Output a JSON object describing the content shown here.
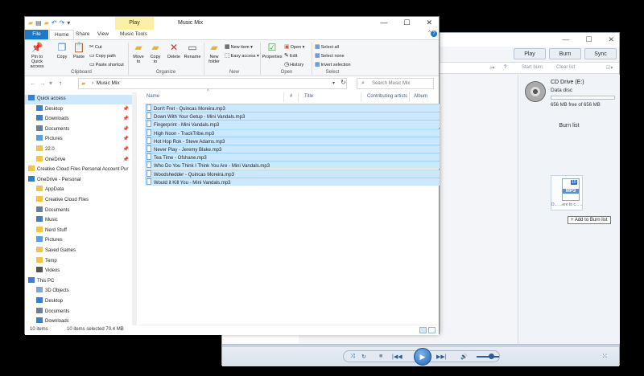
{
  "wmp": {
    "tabs": [
      "Play",
      "Burn",
      "Sync"
    ],
    "toolbar": {
      "start_burn": "Start burn",
      "clear_list": "Clear list"
    },
    "left_label": "ylists",
    "drive": {
      "name": "CD Drive (E:)",
      "type": "Data disc",
      "free": "656 MB free of 656 MB",
      "fill_percent": 0
    },
    "burn_list_title": "Burn list",
    "drag": {
      "tag": "MP3",
      "num": "10",
      "ghost_text": "D... ...ere to c... ...n list."
    },
    "drop_tooltip": "+ Add to Burn list",
    "controls": {
      "shuffle": "⤨",
      "repeat": "↻",
      "stop": "■",
      "prev": "|◀◀",
      "play": "▶",
      "next": "▶▶|",
      "mute": "🔊",
      "switch": "⁙"
    }
  },
  "explorer": {
    "title": "Music Mix",
    "context_tab": "Play",
    "ribbon_tabs": [
      "File",
      "Home",
      "Share",
      "View",
      "Music Tools"
    ],
    "ribbon": {
      "pin": "Pin to Quick access",
      "copy": "Copy",
      "paste": "Paste",
      "cut": "Cut",
      "copy_path": "Copy path",
      "paste_shortcut": "Paste shortcut",
      "clipboard": "Clipboard",
      "move_to": "Move to",
      "copy_to": "Copy to",
      "delete": "Delete",
      "rename": "Rename",
      "organize": "Organize",
      "new_folder": "New folder",
      "new_item": "New item",
      "easy_access": "Easy access",
      "new": "New",
      "properties": "Properties",
      "open": "Open",
      "edit": "Edit",
      "history": "History",
      "open_group": "Open",
      "select_all": "Select all",
      "select_none": "Select none",
      "invert_selection": "Invert selection",
      "select": "Select"
    },
    "address": "Music Mix",
    "search_placeholder": "Search Music Mix",
    "columns": [
      "Name",
      "#",
      "Title",
      "Contributing artists",
      "Album"
    ],
    "nav": [
      {
        "label": "Quick access",
        "pin": false,
        "sel": true,
        "color": "#3a7fd5"
      },
      {
        "label": "Desktop",
        "pin": true,
        "color": "#3a7fd5"
      },
      {
        "label": "Downloads",
        "pin": true,
        "color": "#3a7fd5"
      },
      {
        "label": "Documents",
        "pin": true,
        "color": "#6a7f9a"
      },
      {
        "label": "Pictures",
        "pin": true,
        "color": "#5aa0e0"
      },
      {
        "label": "22.0",
        "pin": true,
        "color": "#f3c44b"
      },
      {
        "label": "OneDrive",
        "pin": true,
        "color": "#f3c44b"
      },
      {
        "label": "Creative Cloud Files Personal Account Pur",
        "pin": false,
        "color": "#f3c44b"
      },
      {
        "label": "OneDrive - Personal",
        "pin": false,
        "color": "#2b7cd3"
      },
      {
        "label": "AppData",
        "pin": false,
        "color": "#f3c44b"
      },
      {
        "label": "Creative Cloud Files",
        "pin": false,
        "color": "#f3c44b"
      },
      {
        "label": "Documents",
        "pin": false,
        "color": "#6a7f9a"
      },
      {
        "label": "Music",
        "pin": false,
        "color": "#3a7fd5"
      },
      {
        "label": "Nerd Stuff",
        "pin": false,
        "color": "#f3c44b"
      },
      {
        "label": "Pictures",
        "pin": false,
        "color": "#5aa0e0"
      },
      {
        "label": "Saved Games",
        "pin": false,
        "color": "#f3c44b"
      },
      {
        "label": "Temp",
        "pin": false,
        "color": "#f3c44b"
      },
      {
        "label": "Videos",
        "pin": false,
        "color": "#555"
      },
      {
        "label": "This PC",
        "pin": false,
        "color": "#3a7fd5"
      },
      {
        "label": "3D Objects",
        "pin": false,
        "color": "#7aa8d8"
      },
      {
        "label": "Desktop",
        "pin": false,
        "color": "#3a7fd5"
      },
      {
        "label": "Documents",
        "pin": false,
        "color": "#6a7f9a"
      },
      {
        "label": "Downloads",
        "pin": false,
        "color": "#3a7fd5"
      }
    ],
    "files": [
      "Don't Fret - Quincas Moreira.mp3",
      "Down With Your Getup - Mini Vandals.mp3",
      "Fingerprint - Mini Vandals.mp3",
      "High Noon - TrackTribe.mp3",
      "Hot Hop Rok - Steve Adams.mp3",
      "Never Play - Jeremy Blake.mp3",
      "Tea Time - Ofshane.mp3",
      "Who Do You Think I Think You Are - Mini Vandals.mp3",
      "Woodshedder - Quincas Moreira.mp3",
      "Would it Kill You - Mini Vandals.mp3"
    ],
    "status": {
      "count": "10 items",
      "selected": "10 items selected  70.4 MB"
    }
  }
}
